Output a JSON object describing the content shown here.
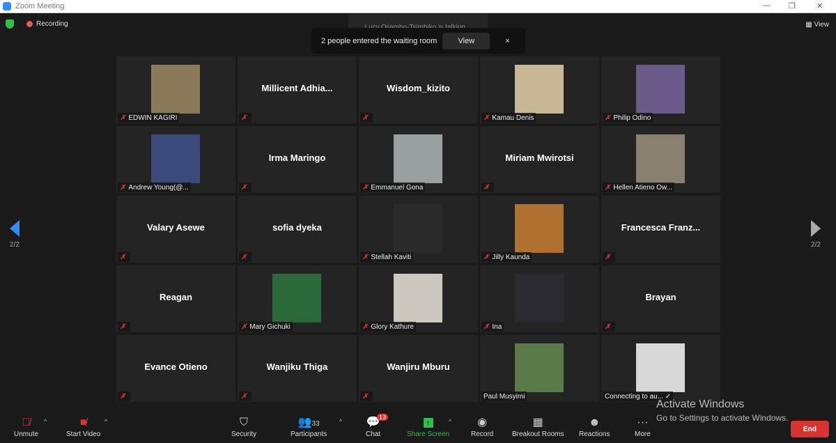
{
  "window": {
    "title": "Zoom Meeting"
  },
  "top": {
    "recording": "Recording",
    "talking": "Lucy.Ojiambo-Tsimbiko is talking...",
    "view": "View"
  },
  "toast": {
    "message": "2 people entered the waiting room",
    "view": "View",
    "close": "×"
  },
  "pagination": {
    "left": "2/2",
    "right": "2/2"
  },
  "tiles": [
    {
      "name": "EDWIN KAGIRI",
      "photo": true,
      "color": "#8a7a5a",
      "muted": true
    },
    {
      "name": "Millicent  Adhia...",
      "photo": false,
      "muted": true
    },
    {
      "name": "Wisdom_kizito",
      "photo": false,
      "muted": true
    },
    {
      "name": "Kamau Denis",
      "photo": true,
      "color": "#c8b896",
      "muted": true
    },
    {
      "name": "Philip Odino",
      "photo": true,
      "color": "#6a5a8a",
      "muted": true
    },
    {
      "name": "Andrew Young(@...",
      "photo": true,
      "color": "#3a4a7a",
      "muted": true
    },
    {
      "name": "Irma Maringo",
      "photo": false,
      "muted": true
    },
    {
      "name": "Emmanuel Gona",
      "photo": true,
      "color": "#9aa0a0",
      "muted": true
    },
    {
      "name": "Miriam Mwirotsi",
      "photo": false,
      "muted": true
    },
    {
      "name": "Hellen Atieno Ow...",
      "photo": true,
      "color": "#8a8070",
      "muted": true
    },
    {
      "name": "Valary Asewe",
      "photo": false,
      "muted": true
    },
    {
      "name": "sofia dyeka",
      "photo": false,
      "muted": true
    },
    {
      "name": "Stellah Kaviti",
      "photo": true,
      "color": "#2a2a2a",
      "muted": true
    },
    {
      "name": "Jilly Kaunda",
      "photo": true,
      "color": "#b07030",
      "muted": true
    },
    {
      "name": "Francesca  Franz...",
      "photo": false,
      "muted": true
    },
    {
      "name": "Reagan",
      "photo": false,
      "muted": true
    },
    {
      "name": "Mary Gichuki",
      "photo": true,
      "color": "#2a6a3a",
      "muted": true
    },
    {
      "name": "Glory Kathure",
      "photo": true,
      "color": "#ccc8c0",
      "muted": true
    },
    {
      "name": "Ina",
      "photo": true,
      "color": "#2a2a30",
      "muted": true
    },
    {
      "name": "Brayan",
      "photo": false,
      "muted": true
    },
    {
      "name": "Evance Otieno",
      "photo": false,
      "muted": true
    },
    {
      "name": "Wanjiku Thiga",
      "photo": false,
      "muted": true
    },
    {
      "name": "Wanjiru Mburu",
      "photo": false,
      "muted": true
    },
    {
      "name": "Paul Musyimi",
      "photo": true,
      "color": "#5a7a4a",
      "muted": false
    },
    {
      "name": "Connecting to au... ✓",
      "photo": true,
      "color": "#d8d8d8",
      "muted": false
    }
  ],
  "toolbar": {
    "unmute": "Unmute",
    "start_video": "Start Video",
    "security": "Security",
    "participants": "Participants",
    "participants_count": "33",
    "chat": "Chat",
    "chat_badge": "13",
    "share": "Share Screen",
    "record": "Record",
    "breakout": "Breakout Rooms",
    "reactions": "Reactions",
    "more": "More",
    "end": "End",
    "share_color": "#2fbf4a"
  },
  "watermark": {
    "line1": "Activate Windows",
    "line2": "Go to Settings to activate Windows."
  }
}
